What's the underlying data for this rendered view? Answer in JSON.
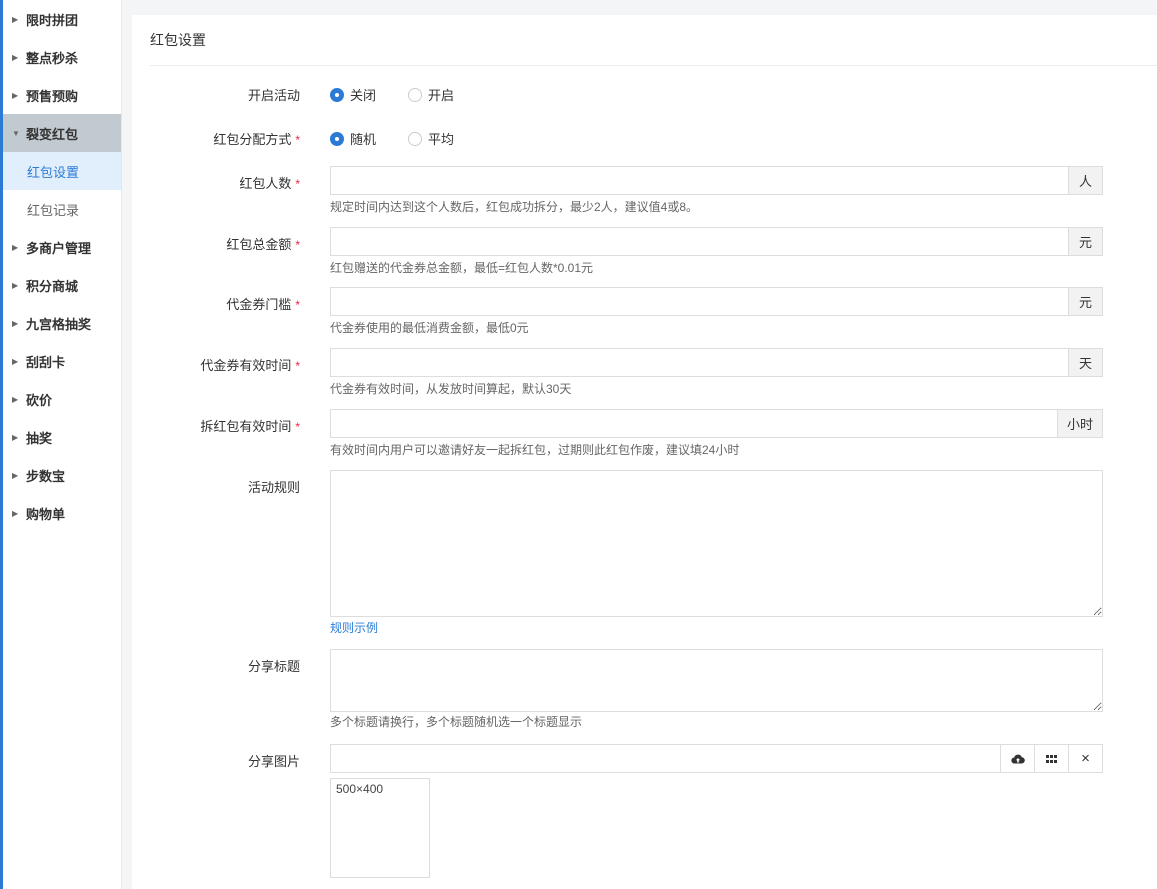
{
  "sidebar": {
    "items": [
      {
        "label": "限时拼团"
      },
      {
        "label": "整点秒杀"
      },
      {
        "label": "预售预购"
      },
      {
        "label": "裂变红包"
      },
      {
        "label": "红包设置"
      },
      {
        "label": "红包记录"
      },
      {
        "label": "多商户管理"
      },
      {
        "label": "积分商城"
      },
      {
        "label": "九宫格抽奖"
      },
      {
        "label": "刮刮卡"
      },
      {
        "label": "砍价"
      },
      {
        "label": "抽奖"
      },
      {
        "label": "步数宝"
      },
      {
        "label": "购物单"
      }
    ]
  },
  "page": {
    "title": "红包设置"
  },
  "form": {
    "activity": {
      "label": "开启活动",
      "options": [
        "关闭",
        "开启"
      ],
      "selected": "关闭"
    },
    "distribution": {
      "label": "红包分配方式",
      "options": [
        "随机",
        "平均"
      ],
      "selected": "随机"
    },
    "people": {
      "label": "红包人数",
      "unit": "人",
      "value": "",
      "help": "规定时间内达到这个人数后，红包成功拆分，最少2人，建议值4或8。"
    },
    "total": {
      "label": "红包总金额",
      "unit": "元",
      "value": "",
      "help": "红包赠送的代金券总金额，最低=红包人数*0.01元"
    },
    "threshold": {
      "label": "代金券门槛",
      "unit": "元",
      "value": "",
      "help": "代金券使用的最低消费金额，最低0元"
    },
    "validity": {
      "label": "代金券有效时间",
      "unit": "天",
      "value": "",
      "help": "代金券有效时间，从发放时间算起，默认30天"
    },
    "split_time": {
      "label": "拆红包有效时间",
      "unit": "小时",
      "value": "",
      "help": "有效时间内用户可以邀请好友一起拆红包，过期则此红包作废，建议填24小时"
    },
    "rules": {
      "label": "活动规则",
      "value": "",
      "link": "规则示例"
    },
    "share_title": {
      "label": "分享标题",
      "value": "",
      "help": "多个标题请换行，多个标题随机选一个标题显示"
    },
    "share_image": {
      "label": "分享图片",
      "value": "",
      "preview_text": "500×400",
      "clear_label": "×"
    }
  },
  "required_mark": "*",
  "colors": {
    "accent": "#2b7bd6",
    "required": "#e24",
    "active_nav": "#c2cad1",
    "active_sub": "#e1eefb"
  },
  "icons": [
    "cloud-upload-icon",
    "grid-icon",
    "close-icon",
    "caret-right-icon",
    "caret-down-icon"
  ]
}
